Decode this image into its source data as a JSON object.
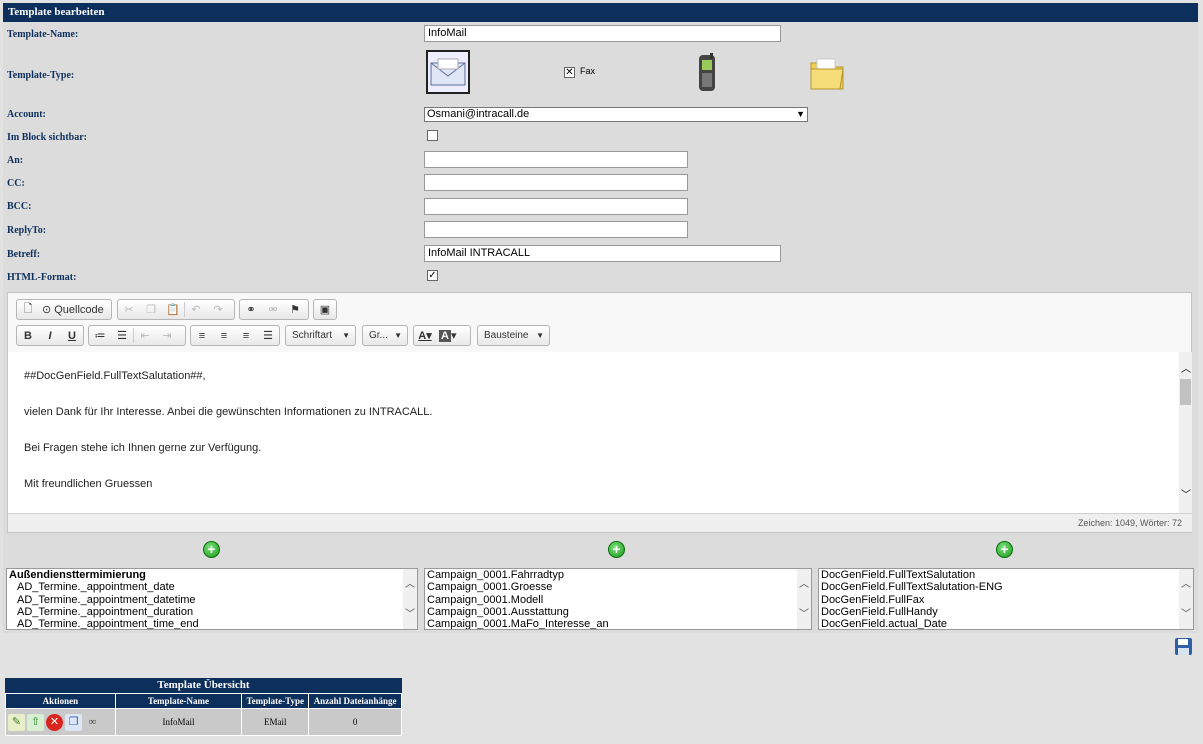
{
  "window": {
    "title": "Template bearbeiten"
  },
  "form": {
    "template_name_label": "Template-Name:",
    "template_name_value": "InfoMail",
    "template_type_label": "Template-Type:",
    "fax_label": "Fax",
    "account_label": "Account:",
    "account_value": "Osmani@intracall.de",
    "im_block_label": "Im Block sichtbar:",
    "an_label": "An:",
    "cc_label": "CC:",
    "bcc_label": "BCC:",
    "replyto_label": "ReplyTo:",
    "betreff_label": "Betreff:",
    "betreff_value": "InfoMail INTRACALL",
    "html_format_label": "HTML-Format:"
  },
  "editor": {
    "source_label": "Quellcode",
    "font_combo": "Schriftart",
    "size_combo": "Gr...",
    "blocks_combo": "Bausteine",
    "lines": [
      "##DocGenField.FullTextSalutation##,",
      "vielen Dank für Ihr Interesse. Anbei die gewünschten Informationen zu INTRACALL.",
      "Bei Fragen stehe ich Ihnen gerne zur Verfügung.",
      "Mit freundlichen Gruessen"
    ],
    "status": "Zeichen: 1049, Wörter: 72"
  },
  "lists": {
    "left": [
      "Außendiensttermimierung",
      "AD_Termine._appointment_date",
      "AD_Termine._appointment_datetime",
      "AD_Termine._appointment_duration",
      "AD_Termine._appointment_time_end"
    ],
    "middle": [
      "Campaign_0001.Fahrradtyp",
      "Campaign_0001.Groesse",
      "Campaign_0001.Modell",
      "Campaign_0001.Ausstattung",
      "Campaign_0001.MaFo_Interesse_an"
    ],
    "right": [
      "DocGenField.FullTextSalutation",
      "DocGenField.FullTextSalutation-ENG",
      "DocGenField.FullFax",
      "DocGenField.FullHandy",
      "DocGenField.actual_Date"
    ]
  },
  "overview": {
    "title": "Template Übersicht",
    "headers": [
      "Aktionen",
      "Template-Name",
      "Template-Type",
      "Anzahl Dateianhänge"
    ],
    "row": {
      "name": "InfoMail",
      "type": "EMail",
      "attachments": "0"
    }
  },
  "colors": {
    "header": "#0d2f5c",
    "panel": "#dcdcdc",
    "add": "#1a9a1a"
  }
}
